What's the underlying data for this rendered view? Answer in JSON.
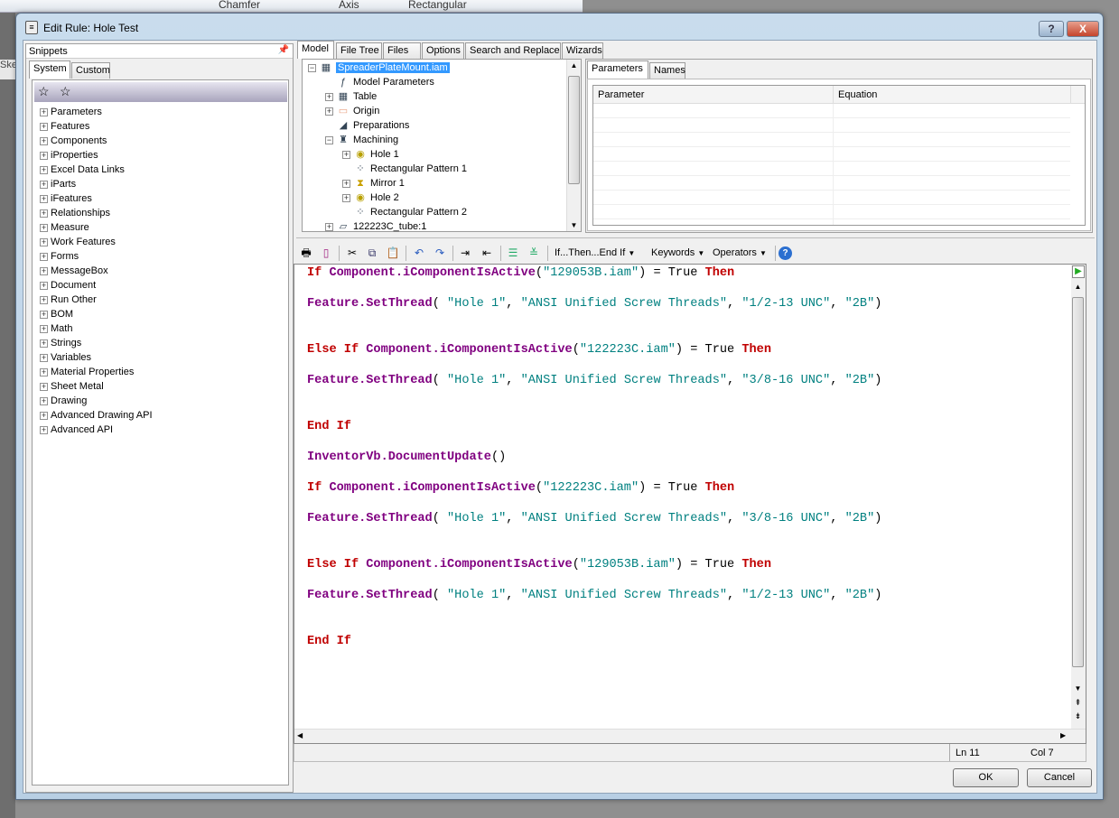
{
  "background_app": {
    "ribbon_items": [
      "Chamfer",
      "Axis",
      "Rectangular"
    ],
    "side_tab": "Sket"
  },
  "dialog": {
    "title": "Edit Rule: Hole Test",
    "help_button": "?",
    "close_button": "X"
  },
  "snippets": {
    "header": "Snippets",
    "tabs": [
      "System",
      "Custom"
    ],
    "active_tab": "System",
    "items": [
      "Parameters",
      "Features",
      "Components",
      "iProperties",
      "Excel Data Links",
      "iParts",
      "iFeatures",
      "Relationships",
      "Measure",
      "Work Features",
      "Forms",
      "MessageBox",
      "Document",
      "Run Other",
      "BOM",
      "Math",
      "Strings",
      "Variables",
      "Material Properties",
      "Sheet Metal",
      "Drawing",
      "Advanced Drawing API",
      "Advanced API"
    ]
  },
  "main_tabs": [
    "Model",
    "File Tree",
    "Files",
    "Options",
    "Search and Replace",
    "Wizards"
  ],
  "active_main_tab": "Model",
  "model_tree": [
    {
      "label": "SpreaderPlateMount.iam",
      "level": 0,
      "expander": "-",
      "icon": "assembly-icon",
      "selected": true
    },
    {
      "label": "Model Parameters",
      "level": 1,
      "expander": "",
      "icon": "fx-icon"
    },
    {
      "label": "Table",
      "level": 1,
      "expander": "+",
      "icon": "table-icon"
    },
    {
      "label": "Origin",
      "level": 1,
      "expander": "+",
      "icon": "folder-icon"
    },
    {
      "label": "Preparations",
      "level": 1,
      "expander": "",
      "icon": "preparations-icon"
    },
    {
      "label": "Machining",
      "level": 1,
      "expander": "-",
      "icon": "machining-icon"
    },
    {
      "label": "Hole 1",
      "level": 2,
      "expander": "+",
      "icon": "hole-icon"
    },
    {
      "label": "Rectangular Pattern 1",
      "level": 2,
      "expander": "",
      "icon": "pattern-icon"
    },
    {
      "label": "Mirror 1",
      "level": 2,
      "expander": "+",
      "icon": "mirror-icon"
    },
    {
      "label": "Hole 2",
      "level": 2,
      "expander": "+",
      "icon": "hole-icon"
    },
    {
      "label": "Rectangular Pattern 2",
      "level": 2,
      "expander": "",
      "icon": "pattern-icon"
    },
    {
      "label": "122223C_tube:1",
      "level": 1,
      "expander": "+",
      "icon": "part-icon"
    }
  ],
  "parameters_panel": {
    "tabs": [
      "Parameters",
      "Names"
    ],
    "active_tab": "Parameters",
    "columns": [
      "Parameter",
      "Equation"
    ],
    "rows": []
  },
  "editor_toolbar": {
    "menus": [
      "If...Then...End If",
      "Keywords",
      "Operators"
    ]
  },
  "code_lines": [
    [
      [
        "kw",
        "If "
      ],
      [
        "mb",
        "Component.iComponentIsActive"
      ],
      [
        "pl",
        "("
      ],
      [
        "st",
        "\"129053B.iam\""
      ],
      [
        "pl",
        ") = True "
      ],
      [
        "kw",
        "Then"
      ]
    ],
    [],
    [
      [
        "mb",
        "Feature.SetThread"
      ],
      [
        "pl",
        "( "
      ],
      [
        "st",
        "\"Hole 1\""
      ],
      [
        "pl",
        ", "
      ],
      [
        "st",
        "\"ANSI Unified Screw Threads\""
      ],
      [
        "pl",
        ", "
      ],
      [
        "st",
        "\"1/2-13 UNC\""
      ],
      [
        "pl",
        ", "
      ],
      [
        "st",
        "\"2B\""
      ],
      [
        "pl",
        ")"
      ]
    ],
    [],
    [],
    [
      [
        "kw",
        "Else If "
      ],
      [
        "mb",
        "Component.iComponentIsActive"
      ],
      [
        "pl",
        "("
      ],
      [
        "st",
        "\"122223C.iam\""
      ],
      [
        "pl",
        ") = True "
      ],
      [
        "kw",
        "Then"
      ]
    ],
    [],
    [
      [
        "mb",
        "Feature.SetThread"
      ],
      [
        "pl",
        "( "
      ],
      [
        "st",
        "\"Hole 1\""
      ],
      [
        "pl",
        ", "
      ],
      [
        "st",
        "\"ANSI Unified Screw Threads\""
      ],
      [
        "pl",
        ", "
      ],
      [
        "st",
        "\"3/8-16 UNC\""
      ],
      [
        "pl",
        ", "
      ],
      [
        "st",
        "\"2B\""
      ],
      [
        "pl",
        ")"
      ]
    ],
    [],
    [],
    [
      [
        "kw",
        "End If"
      ]
    ],
    [],
    [
      [
        "mb",
        "InventorVb.DocumentUpdate"
      ],
      [
        "pl",
        "()"
      ]
    ],
    [],
    [
      [
        "kw",
        "If "
      ],
      [
        "mb",
        "Component.iComponentIsActive"
      ],
      [
        "pl",
        "("
      ],
      [
        "st",
        "\"122223C.iam\""
      ],
      [
        "pl",
        ") = True "
      ],
      [
        "kw",
        "Then"
      ]
    ],
    [],
    [
      [
        "mb",
        "Feature.SetThread"
      ],
      [
        "pl",
        "( "
      ],
      [
        "st",
        "\"Hole 1\""
      ],
      [
        "pl",
        ", "
      ],
      [
        "st",
        "\"ANSI Unified Screw Threads\""
      ],
      [
        "pl",
        ", "
      ],
      [
        "st",
        "\"3/8-16 UNC\""
      ],
      [
        "pl",
        ", "
      ],
      [
        "st",
        "\"2B\""
      ],
      [
        "pl",
        ")"
      ]
    ],
    [],
    [],
    [
      [
        "kw",
        "Else If "
      ],
      [
        "mb",
        "Component.iComponentIsActive"
      ],
      [
        "pl",
        "("
      ],
      [
        "st",
        "\"129053B.iam\""
      ],
      [
        "pl",
        ") = True "
      ],
      [
        "kw",
        "Then"
      ]
    ],
    [],
    [
      [
        "mb",
        "Feature.SetThread"
      ],
      [
        "pl",
        "( "
      ],
      [
        "st",
        "\"Hole 1\""
      ],
      [
        "pl",
        ", "
      ],
      [
        "st",
        "\"ANSI Unified Screw Threads\""
      ],
      [
        "pl",
        ", "
      ],
      [
        "st",
        "\"1/2-13 UNC\""
      ],
      [
        "pl",
        ", "
      ],
      [
        "st",
        "\"2B\""
      ],
      [
        "pl",
        ")"
      ]
    ],
    [],
    [],
    [
      [
        "kw",
        "End If"
      ]
    ]
  ],
  "syntax_colors": {
    "keyword": "#c00000",
    "member": "#800080",
    "string": "#008080"
  },
  "status": {
    "line": "Ln 11",
    "col": "Col 7"
  },
  "buttons": {
    "ok": "OK",
    "cancel": "Cancel"
  }
}
